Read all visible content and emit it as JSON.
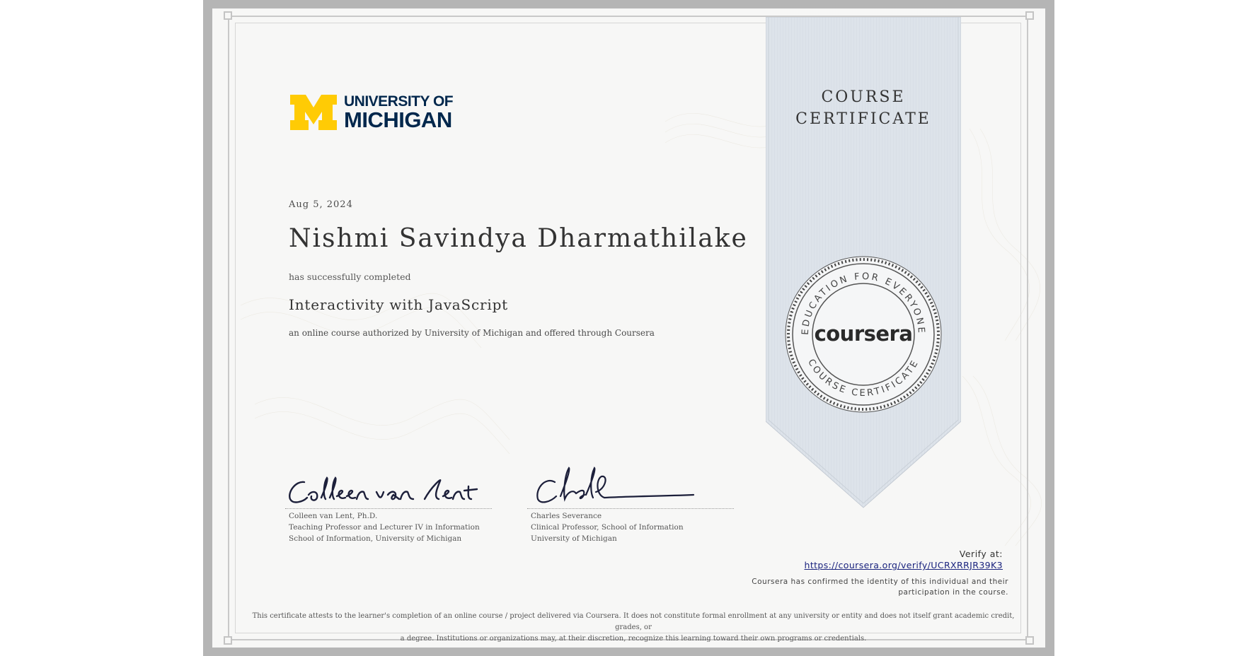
{
  "university": {
    "logo_line1": "UNIVERSITY OF",
    "logo_line2": "MICHIGAN",
    "colors": {
      "blue": "#00274c",
      "maize": "#ffcb05"
    }
  },
  "certificate": {
    "date": "Aug 5, 2024",
    "learner_name": "Nishmi Savindya Dharmathilake",
    "completed_text": "has successfully completed",
    "course_title": "Interactivity with JavaScript",
    "offered_text": "an online course authorized by University of Michigan and offered through Coursera",
    "ribbon_line1": "COURSE",
    "ribbon_line2": "CERTIFICATE"
  },
  "seal": {
    "brand": "coursera",
    "top_arc": "EDUCATION FOR EVERYONE",
    "bottom_arc": "COURSE CERTIFICATE"
  },
  "signatories": [
    {
      "signature": "Colleen van Lent",
      "name": "Colleen van Lent, Ph.D.",
      "title": "Teaching Professor and Lecturer IV in Information",
      "affiliation": "School of Information, University of Michigan"
    },
    {
      "signature": "Chuck",
      "name": "Charles Severance",
      "title": "Clinical Professor, School of Information",
      "affiliation": "University of Michigan"
    }
  ],
  "verify": {
    "label": "Verify at:",
    "url": "https://coursera.org/verify/UCRXRRJR39K3",
    "note_line1": "Coursera has confirmed the identity of this individual and their",
    "note_line2": "participation in the course."
  },
  "disclaimer": {
    "line1": "This certificate attests to the learner's completion of an online course / project delivered via Coursera. It does not constitute formal enrollment at any university or entity and does not itself grant academic credit, grades, or",
    "line2": "a degree. Institutions or organizations may, at their discretion, recognize this learning toward their own programs or credentials."
  }
}
